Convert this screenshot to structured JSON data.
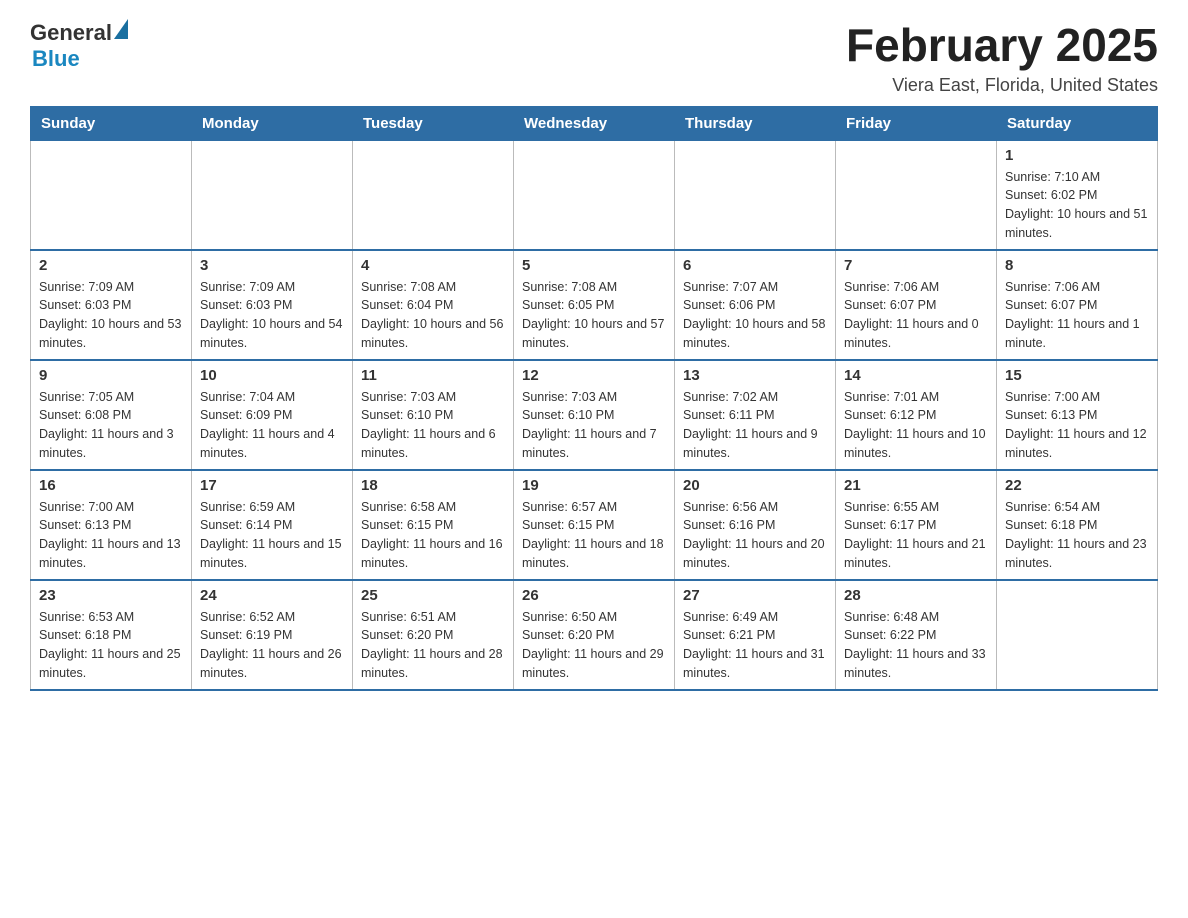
{
  "header": {
    "logo": {
      "general": "General",
      "blue": "Blue",
      "tagline": ""
    },
    "title": "February 2025",
    "location": "Viera East, Florida, United States"
  },
  "days_of_week": [
    "Sunday",
    "Monday",
    "Tuesday",
    "Wednesday",
    "Thursday",
    "Friday",
    "Saturday"
  ],
  "weeks": [
    [
      {
        "day": "",
        "info": ""
      },
      {
        "day": "",
        "info": ""
      },
      {
        "day": "",
        "info": ""
      },
      {
        "day": "",
        "info": ""
      },
      {
        "day": "",
        "info": ""
      },
      {
        "day": "",
        "info": ""
      },
      {
        "day": "1",
        "info": "Sunrise: 7:10 AM\nSunset: 6:02 PM\nDaylight: 10 hours and 51 minutes."
      }
    ],
    [
      {
        "day": "2",
        "info": "Sunrise: 7:09 AM\nSunset: 6:03 PM\nDaylight: 10 hours and 53 minutes."
      },
      {
        "day": "3",
        "info": "Sunrise: 7:09 AM\nSunset: 6:03 PM\nDaylight: 10 hours and 54 minutes."
      },
      {
        "day": "4",
        "info": "Sunrise: 7:08 AM\nSunset: 6:04 PM\nDaylight: 10 hours and 56 minutes."
      },
      {
        "day": "5",
        "info": "Sunrise: 7:08 AM\nSunset: 6:05 PM\nDaylight: 10 hours and 57 minutes."
      },
      {
        "day": "6",
        "info": "Sunrise: 7:07 AM\nSunset: 6:06 PM\nDaylight: 10 hours and 58 minutes."
      },
      {
        "day": "7",
        "info": "Sunrise: 7:06 AM\nSunset: 6:07 PM\nDaylight: 11 hours and 0 minutes."
      },
      {
        "day": "8",
        "info": "Sunrise: 7:06 AM\nSunset: 6:07 PM\nDaylight: 11 hours and 1 minute."
      }
    ],
    [
      {
        "day": "9",
        "info": "Sunrise: 7:05 AM\nSunset: 6:08 PM\nDaylight: 11 hours and 3 minutes."
      },
      {
        "day": "10",
        "info": "Sunrise: 7:04 AM\nSunset: 6:09 PM\nDaylight: 11 hours and 4 minutes."
      },
      {
        "day": "11",
        "info": "Sunrise: 7:03 AM\nSunset: 6:10 PM\nDaylight: 11 hours and 6 minutes."
      },
      {
        "day": "12",
        "info": "Sunrise: 7:03 AM\nSunset: 6:10 PM\nDaylight: 11 hours and 7 minutes."
      },
      {
        "day": "13",
        "info": "Sunrise: 7:02 AM\nSunset: 6:11 PM\nDaylight: 11 hours and 9 minutes."
      },
      {
        "day": "14",
        "info": "Sunrise: 7:01 AM\nSunset: 6:12 PM\nDaylight: 11 hours and 10 minutes."
      },
      {
        "day": "15",
        "info": "Sunrise: 7:00 AM\nSunset: 6:13 PM\nDaylight: 11 hours and 12 minutes."
      }
    ],
    [
      {
        "day": "16",
        "info": "Sunrise: 7:00 AM\nSunset: 6:13 PM\nDaylight: 11 hours and 13 minutes."
      },
      {
        "day": "17",
        "info": "Sunrise: 6:59 AM\nSunset: 6:14 PM\nDaylight: 11 hours and 15 minutes."
      },
      {
        "day": "18",
        "info": "Sunrise: 6:58 AM\nSunset: 6:15 PM\nDaylight: 11 hours and 16 minutes."
      },
      {
        "day": "19",
        "info": "Sunrise: 6:57 AM\nSunset: 6:15 PM\nDaylight: 11 hours and 18 minutes."
      },
      {
        "day": "20",
        "info": "Sunrise: 6:56 AM\nSunset: 6:16 PM\nDaylight: 11 hours and 20 minutes."
      },
      {
        "day": "21",
        "info": "Sunrise: 6:55 AM\nSunset: 6:17 PM\nDaylight: 11 hours and 21 minutes."
      },
      {
        "day": "22",
        "info": "Sunrise: 6:54 AM\nSunset: 6:18 PM\nDaylight: 11 hours and 23 minutes."
      }
    ],
    [
      {
        "day": "23",
        "info": "Sunrise: 6:53 AM\nSunset: 6:18 PM\nDaylight: 11 hours and 25 minutes."
      },
      {
        "day": "24",
        "info": "Sunrise: 6:52 AM\nSunset: 6:19 PM\nDaylight: 11 hours and 26 minutes."
      },
      {
        "day": "25",
        "info": "Sunrise: 6:51 AM\nSunset: 6:20 PM\nDaylight: 11 hours and 28 minutes."
      },
      {
        "day": "26",
        "info": "Sunrise: 6:50 AM\nSunset: 6:20 PM\nDaylight: 11 hours and 29 minutes."
      },
      {
        "day": "27",
        "info": "Sunrise: 6:49 AM\nSunset: 6:21 PM\nDaylight: 11 hours and 31 minutes."
      },
      {
        "day": "28",
        "info": "Sunrise: 6:48 AM\nSunset: 6:22 PM\nDaylight: 11 hours and 33 minutes."
      },
      {
        "day": "",
        "info": ""
      }
    ]
  ]
}
